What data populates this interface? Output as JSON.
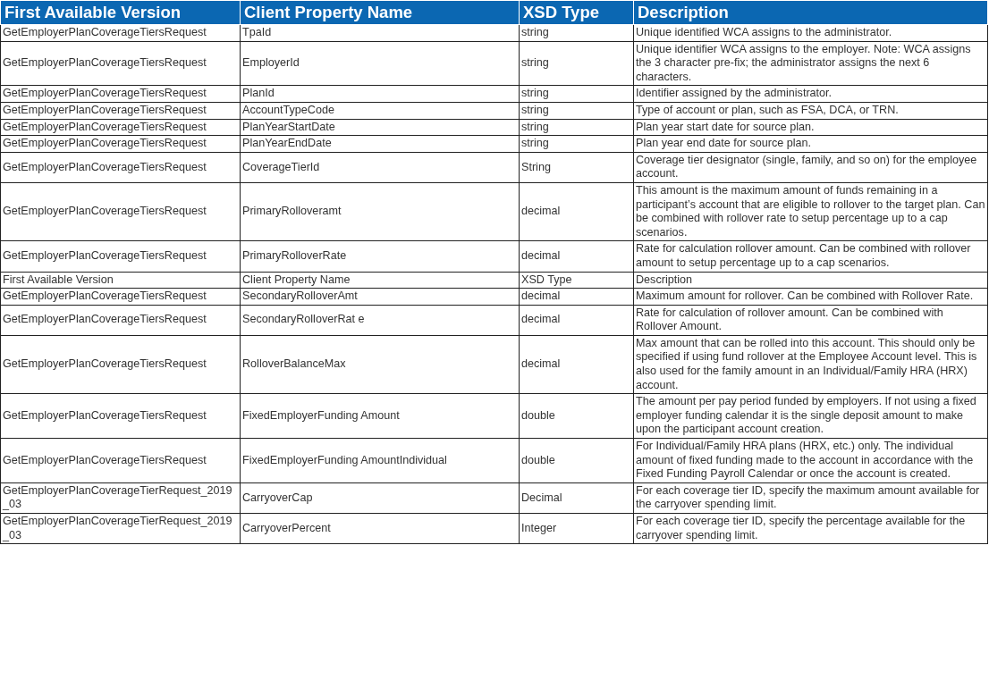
{
  "table": {
    "columns": [
      "First Available Version",
      "Client Property Name",
      "XSD Type",
      "Description"
    ],
    "rows": [
      [
        "GetEmployerPlanCoverageTiersRequest",
        "TpaId",
        "string",
        "Unique identified WCA assigns to the administrator."
      ],
      [
        "GetEmployerPlanCoverageTiersRequest",
        "EmployerId",
        "string",
        "Unique identifier WCA assigns to the employer. Note: WCA assigns the 3 character pre-fix; the administrator assigns the next 6 characters."
      ],
      [
        "GetEmployerPlanCoverageTiersRequest",
        "PlanId",
        "string",
        "Identifier assigned by the administrator."
      ],
      [
        "GetEmployerPlanCoverageTiersRequest",
        "AccountTypeCode",
        "string",
        "Type of account or plan, such as FSA, DCA, or TRN."
      ],
      [
        "GetEmployerPlanCoverageTiersRequest",
        "PlanYearStartDate",
        "string",
        "Plan year start date for source plan."
      ],
      [
        "GetEmployerPlanCoverageTiersRequest",
        "PlanYearEndDate",
        "string",
        "Plan year end date for source plan."
      ],
      [
        "GetEmployerPlanCoverageTiersRequest",
        "CoverageTierId",
        "String",
        "Coverage tier designator (single, family, and so on) for the employee account."
      ],
      [
        "GetEmployerPlanCoverageTiersRequest",
        "PrimaryRolloveramt",
        "decimal",
        "This amount is the maximum amount of funds remaining in a participant’s account that are eligible to rollover to the target plan.  Can be combined with rollover rate to setup percentage up to a cap scenarios."
      ],
      [
        "GetEmployerPlanCoverageTiersRequest",
        "PrimaryRolloverRate",
        "decimal",
        "Rate for calculation rollover amount. Can be combined with rollover amount to setup percentage up to a cap scenarios."
      ],
      [
        "First Available Version",
        "Client Property Name",
        "XSD Type",
        "Description"
      ],
      [
        "GetEmployerPlanCoverageTiersRequest",
        "SecondaryRolloverAmt",
        "decimal",
        "Maximum amount for rollover. Can be combined with Rollover Rate."
      ],
      [
        "GetEmployerPlanCoverageTiersRequest",
        "SecondaryRolloverRat e",
        "decimal",
        "Rate for calculation of rollover amount. Can be combined with Rollover Amount."
      ],
      [
        "GetEmployerPlanCoverageTiersRequest",
        "RolloverBalanceMax",
        "decimal",
        "Max amount that can be rolled into this account. This should only be specified if using fund rollover at the Employee Account level. This is also used for the family amount in an Individual/Family HRA (HRX) account."
      ],
      [
        "GetEmployerPlanCoverageTiersRequest",
        "FixedEmployerFunding Amount",
        "double",
        "The amount per pay period funded by employers. If not using a fixed employer funding calendar it is the single deposit amount to make upon the participant account creation."
      ],
      [
        "GetEmployerPlanCoverageTiersRequest",
        "FixedEmployerFunding AmountIndividual",
        "double",
        "For Individual/Family HRA plans (HRX, etc.) only. The individual amount of fixed funding made to the account in accordance with the Fixed Funding Payroll Calendar or once the account is created."
      ],
      [
        "GetEmployerPlanCoverageTierRequest_2019_03",
        "CarryoverCap",
        "Decimal",
        "For each coverage tier ID, specify the maximum amount available for the carryover spending limit."
      ],
      [
        "GetEmployerPlanCoverageTierRequest_2019_03",
        "CarryoverPercent",
        "Integer",
        "For each coverage tier ID, specify the percentage available for the carryover spending limit."
      ]
    ]
  }
}
